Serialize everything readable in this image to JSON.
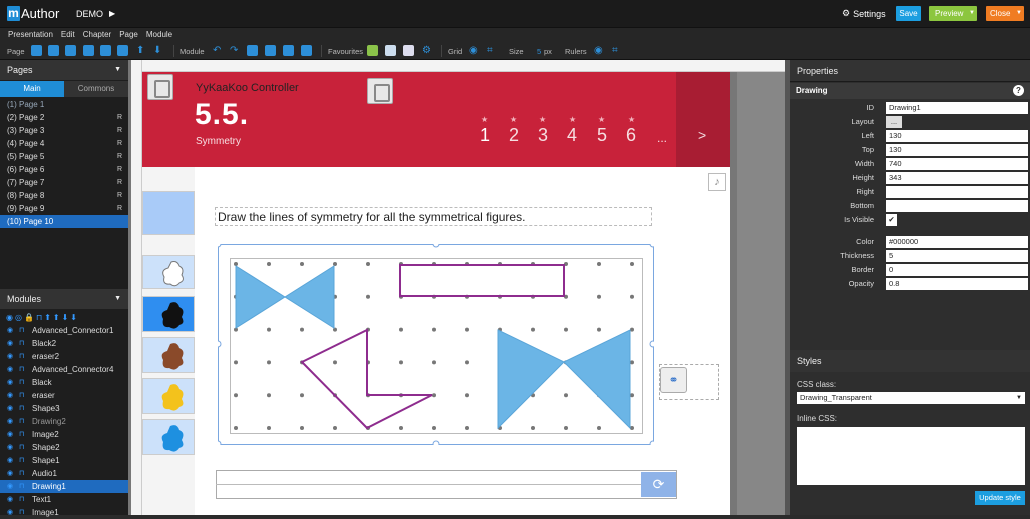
{
  "app": {
    "logo_m": "m",
    "logo_text": "Author",
    "project": "DEMO"
  },
  "topbar": {
    "settings_label": "Settings",
    "save_label": "Save",
    "preview_label": "Preview",
    "close_label": "Close"
  },
  "menu": [
    "Presentation",
    "Edit",
    "Chapter",
    "Page",
    "Module"
  ],
  "toolbar": {
    "page": "Page",
    "module": "Module",
    "favourites": "Favourites",
    "grid": "Grid",
    "size": "Size",
    "size_value": "5",
    "size_unit": "px",
    "rulers": "Rulers"
  },
  "pages_panel": {
    "title": "Pages",
    "tabs": [
      "Main",
      "Commons"
    ],
    "items": [
      {
        "label": "(1) Page 1",
        "r": ""
      },
      {
        "label": "(2) Page 2",
        "r": "R"
      },
      {
        "label": "(3) Page 3",
        "r": "R"
      },
      {
        "label": "(4) Page 4",
        "r": "R"
      },
      {
        "label": "(5) Page 5",
        "r": "R"
      },
      {
        "label": "(6) Page 6",
        "r": "R"
      },
      {
        "label": "(7) Page 7",
        "r": "R"
      },
      {
        "label": "(8) Page 8",
        "r": "R"
      },
      {
        "label": "(9) Page 9",
        "r": "R"
      },
      {
        "label": "(10) Page 10",
        "r": ""
      }
    ]
  },
  "modules_panel": {
    "title": "Modules",
    "items": [
      "Advanced_Connector1",
      "Black2",
      "eraser2",
      "Advanced_Connector4",
      "Black",
      "eraser",
      "Shape3",
      "Drawing2",
      "Image2",
      "Shape2",
      "Shape1",
      "Audio1",
      "Drawing1",
      "Text1",
      "Image1"
    ]
  },
  "lesson": {
    "controller_title": "YyKaaKoo Controller",
    "number": "5.5.",
    "subtitle": "Symmetry",
    "pages": [
      "1",
      "2",
      "3",
      "4",
      "5",
      "6",
      "...",
      ">"
    ],
    "instruction": "Draw the lines of symmetry for all the symmetrical figures."
  },
  "properties": {
    "title": "Properties",
    "module": "Drawing",
    "fields": [
      {
        "key": "ID",
        "value": "Drawing1"
      },
      {
        "key": "Layout",
        "value": "..."
      },
      {
        "key": "Left",
        "value": "130"
      },
      {
        "key": "Top",
        "value": "130"
      },
      {
        "key": "Width",
        "value": "740"
      },
      {
        "key": "Height",
        "value": "343"
      },
      {
        "key": "Right",
        "value": ""
      },
      {
        "key": "Bottom",
        "value": ""
      },
      {
        "key": "Is Visible",
        "value": "✔"
      },
      {
        "key": "Color",
        "value": "#000000"
      },
      {
        "key": "Thickness",
        "value": "5"
      },
      {
        "key": "Border",
        "value": "0"
      },
      {
        "key": "Opacity",
        "value": "0.8"
      }
    ]
  },
  "styles": {
    "title": "Styles",
    "css_label": "CSS class:",
    "css_value": "Drawing_Transparent",
    "inline_label": "Inline CSS:",
    "update_label": "Update style"
  },
  "colors": {
    "accent": "#1f8dd6",
    "header_red": "#c8223a",
    "shape_blue": "#6bb5e6",
    "shape_purple": "#8e2c8e"
  }
}
